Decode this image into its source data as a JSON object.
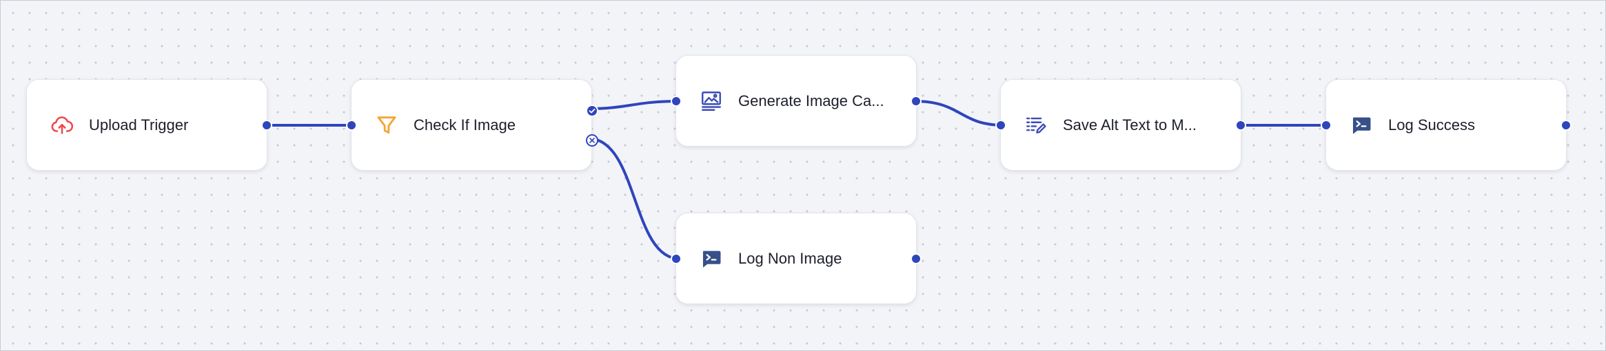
{
  "canvas": {
    "edge_color": "#2f45bd",
    "background": "#f3f4f8"
  },
  "nodes": {
    "upload_trigger": {
      "label": "Upload Trigger",
      "icon": "cloud-upload-icon",
      "icon_color": "#f0484e"
    },
    "check_if_image": {
      "label": "Check If Image",
      "icon": "filter-funnel-icon",
      "icon_color": "#f5a431"
    },
    "generate_caption": {
      "label": "Generate Image Ca...",
      "icon": "image-caption-icon",
      "icon_color": "#3a4bb8"
    },
    "save_alt_text": {
      "label": "Save Alt Text to M...",
      "icon": "text-edit-icon",
      "icon_color": "#3a4bb8"
    },
    "log_success": {
      "label": "Log Success",
      "icon": "terminal-icon",
      "icon_color": "#37508a"
    },
    "log_non_image": {
      "label": "Log Non Image",
      "icon": "terminal-icon",
      "icon_color": "#37508a"
    }
  },
  "branches": {
    "true_icon": "check-icon",
    "false_icon": "x-circle-icon"
  }
}
